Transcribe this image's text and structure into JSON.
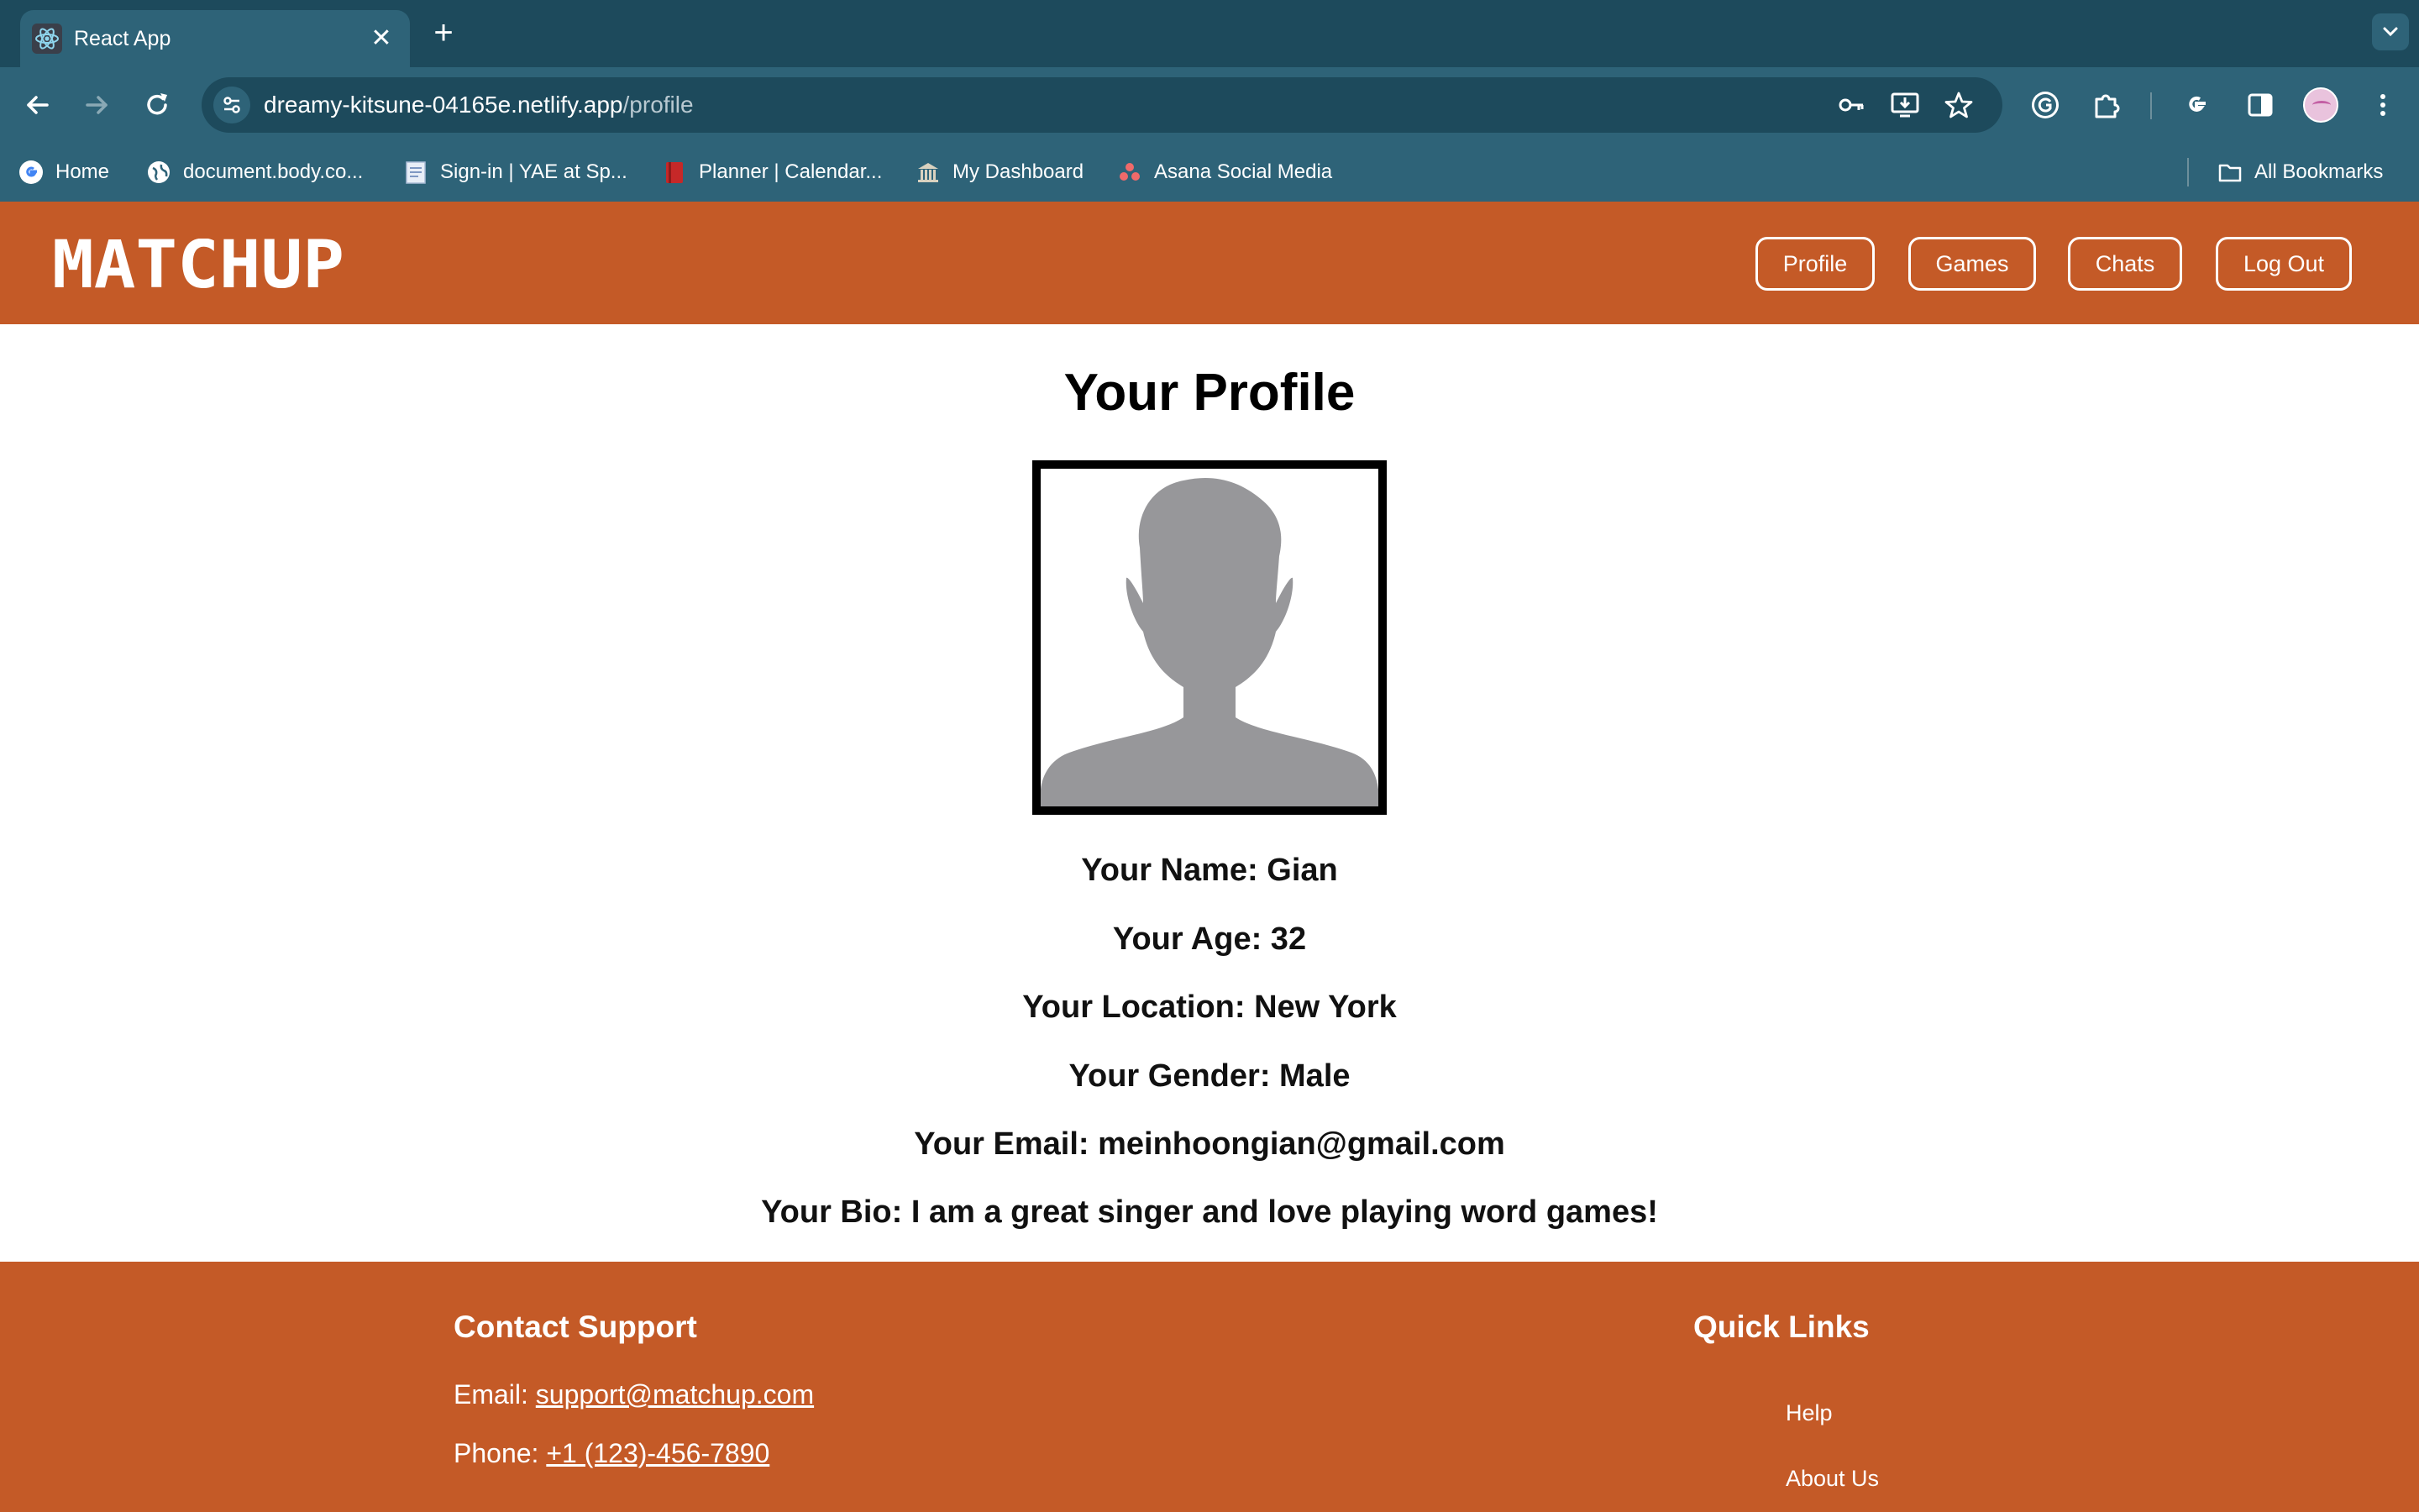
{
  "browser": {
    "tab_title": "React App",
    "tab_close": "✕",
    "new_tab": "+",
    "url_host": "dreamy-kitsune-04165e.netlify.app",
    "url_path": "/profile",
    "bookmarks": [
      {
        "label": "Home",
        "icon": "google-icon"
      },
      {
        "label": "document.body.co...",
        "icon": "globe-icon"
      },
      {
        "label": "Sign-in | YAE at Sp...",
        "icon": "document-icon"
      },
      {
        "label": "Planner | Calendar...",
        "icon": "planner-icon"
      },
      {
        "label": "My Dashboard",
        "icon": "building-icon"
      },
      {
        "label": "Asana Social Media",
        "icon": "asana-icon"
      }
    ],
    "all_bookmarks": "All Bookmarks"
  },
  "app": {
    "logo": "MATCHUP",
    "nav": {
      "profile": "Profile",
      "games": "Games",
      "chats": "Chats",
      "logout": "Log Out"
    }
  },
  "profile": {
    "title": "Your Profile",
    "name": "Your Name: Gian",
    "age": "Your Age: 32",
    "location": "Your Location: New York",
    "gender": "Your Gender: Male",
    "email": "Your Email: meinhoongian@gmail.com",
    "bio": "Your Bio: I am a great singer and love playing word games!"
  },
  "footer": {
    "contact_heading": "Contact Support",
    "email_label": "Email: ",
    "email_value": "support@matchup.com",
    "phone_label": "Phone: ",
    "phone_value": "+1 (123)-456-7890",
    "quick_links_heading": "Quick Links",
    "quick_links": [
      "Help",
      "About Us"
    ]
  },
  "colors": {
    "chrome_dark": "#1d4a5c",
    "chrome": "#2e6378",
    "brand_orange": "#c45a27",
    "placeholder_gray": "#97979a"
  }
}
